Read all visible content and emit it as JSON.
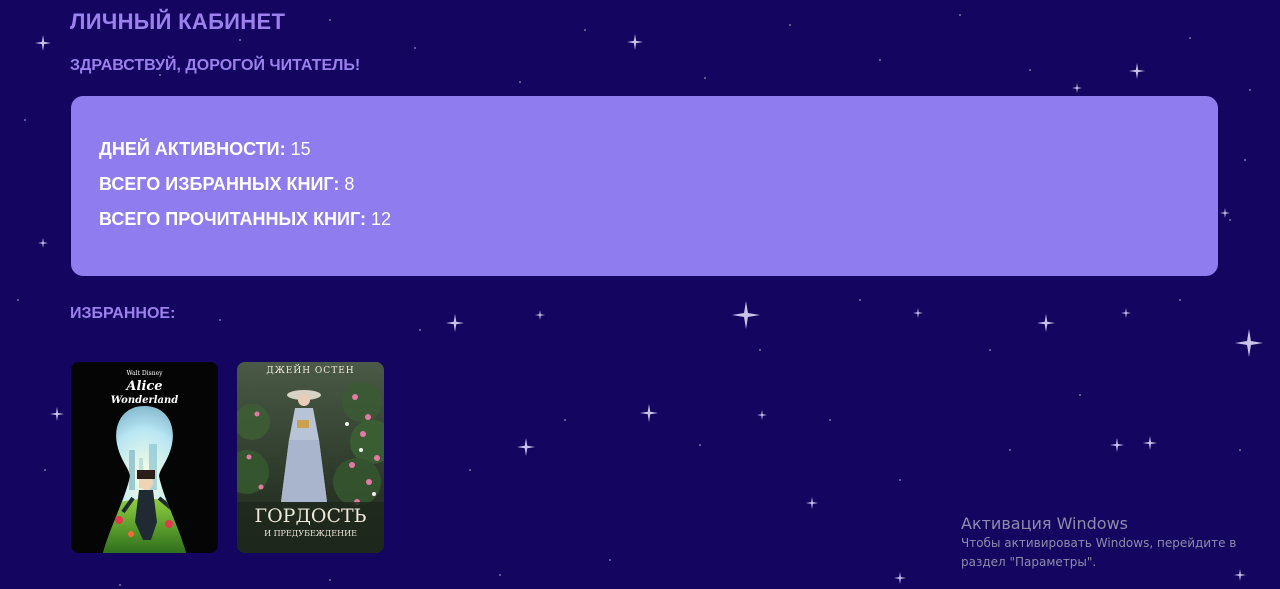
{
  "header": {
    "title": "ЛИЧНЫЙ КАБИНЕТ",
    "greeting": "ЗДРАВСТВУЙ, ДОРОГОЙ ЧИТАТЕЛЬ!"
  },
  "stats": {
    "active_days": {
      "label": "ДНЕЙ АКТИВНОСТИ:",
      "value": "15"
    },
    "favorite_books": {
      "label": "ВСЕГО ИЗБРАННЫХ КНИГ:",
      "value": "8"
    },
    "read_books": {
      "label": "ВСЕГО ПРОЧИТАННЫХ КНИГ:",
      "value": "12"
    }
  },
  "favorites": {
    "heading": "ИЗБРАННОЕ:",
    "books": [
      {
        "cover_top": "Walt Disney",
        "cover_title_1": "Alice",
        "cover_title_2": "Wonderland"
      },
      {
        "cover_top": "ДЖЕЙН ОСТЕН",
        "cover_title_1": "ГОРДОСТЬ",
        "cover_title_2": "И ПРЕДУБЕЖДЕНИЕ"
      }
    ]
  },
  "watermark": {
    "title": "Активация Windows",
    "text": "Чтобы активировать Windows, перейдите в раздел \"Параметры\"."
  },
  "colors": {
    "background": "#140660",
    "accent": "#9b80ee",
    "card": "#8f7cee"
  }
}
